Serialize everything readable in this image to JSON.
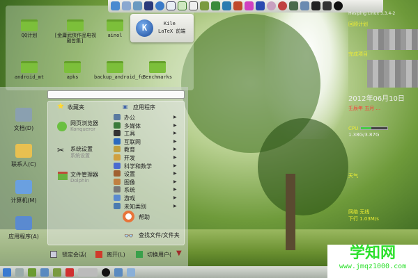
{
  "desktop": {
    "folders": [
      "QQ计划",
      "[金庸武侠作品电视剧합集]",
      "ainol",
      "android_mt",
      "apks",
      "backup_android_fo",
      "Benchmarks"
    ]
  },
  "tooltip": {
    "title": "Kile",
    "subtitle": "LaTeX 前端"
  },
  "menu": {
    "search_placeholder": "",
    "left": [
      {
        "label": "文档(D)"
      },
      {
        "label": "联系人(C)"
      },
      {
        "label": "计算机(M)"
      },
      {
        "label": "应用程序(A)"
      }
    ],
    "favorites_header": "收藏夹",
    "favorites": [
      {
        "name": "网页浏览器",
        "sub": "Konqueror"
      },
      {
        "name": "系统设置",
        "sub": "系统设置"
      },
      {
        "name": "文件管理器",
        "sub": "Dolphin"
      }
    ],
    "apps_header": "应用程序",
    "categories": [
      "办公",
      "多媒体",
      "工具",
      "互联网",
      "教育",
      "开发",
      "科学和数学",
      "设置",
      "图像",
      "系统",
      "游戏",
      "未知类别"
    ],
    "help": "帮助",
    "find": "查找文件/文件夹",
    "bottom": {
      "lock": "锁定会话(",
      "leave": "离开(L)",
      "switch": "切换用户("
    }
  },
  "widgets": {
    "user": "Hesiping Linux 3.3.4-2",
    "plan": "回顾计划",
    "done": "完成项目",
    "date": "2012年06月10日",
    "lunar": "壬辰年 五月 ...",
    "cpu": "CPU",
    "mem": "1.38G/3.87G",
    "weather": "天气",
    "net": "网络 无线",
    "down": "下行 1.03M/s"
  },
  "watermark": {
    "title": "学知网",
    "url": "www.jmqz1000.com"
  }
}
